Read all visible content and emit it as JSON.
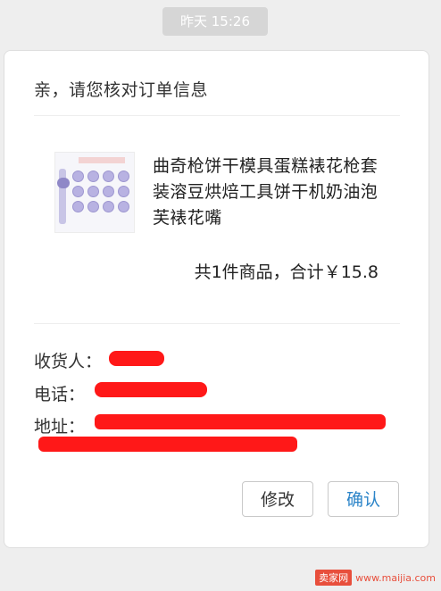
{
  "timestamp": "昨天 15:26",
  "card": {
    "title": "亲，请您核对订单信息",
    "product": {
      "image_icon": "cookie-press-product-image",
      "name": "曲奇枪饼干模具蛋糕裱花枪套装溶豆烘焙工具饼干机奶油泡芙裱花嘴"
    },
    "summary": {
      "count_text": "共1件商品，",
      "total_label": "合计",
      "total_value": "￥15.8"
    },
    "fields": {
      "recipient_label": "收货人：",
      "phone_label": "电话：",
      "address_label": "地址："
    },
    "buttons": {
      "modify": "修改",
      "confirm": "确认"
    }
  },
  "watermark": {
    "logo": "卖家网",
    "url": "www.maijia.com"
  },
  "colors": {
    "confirm": "#2b84c8",
    "redaction": "#ff1818"
  }
}
